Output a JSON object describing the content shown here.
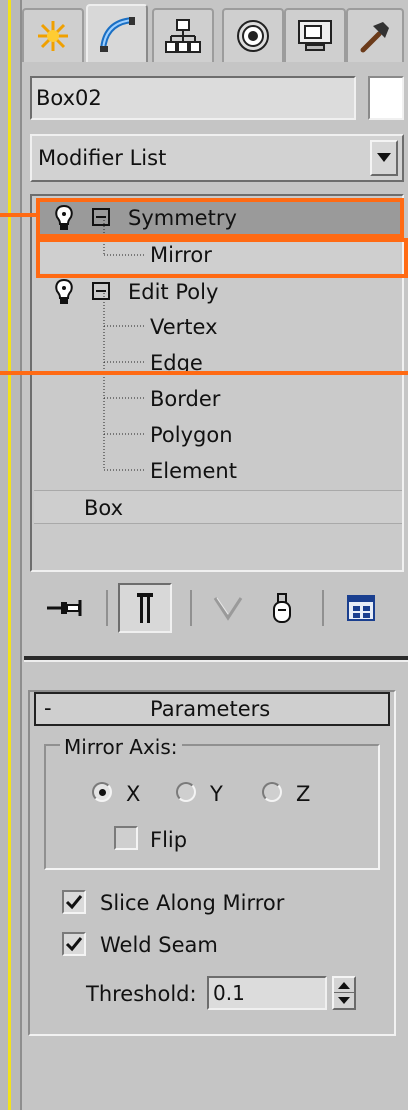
{
  "object": {
    "name": "Box02",
    "color": "#ffffff"
  },
  "modifier_list": {
    "label": "Modifier List"
  },
  "tabs": [
    {
      "name": "create-tab",
      "icon": "sun-icon"
    },
    {
      "name": "modify-tab",
      "icon": "modify-curve-icon",
      "active": true
    },
    {
      "name": "hierarchy-tab",
      "icon": "hierarchy-icon"
    },
    {
      "name": "motion-tab",
      "icon": "motion-target-icon"
    },
    {
      "name": "display-tab",
      "icon": "monitor-icon"
    },
    {
      "name": "utilities-tab",
      "icon": "hammer-icon"
    }
  ],
  "stack": {
    "symmetry": "Symmetry",
    "mirror": "Mirror",
    "edit_poly": "Edit Poly",
    "vertex": "Vertex",
    "edge": "Edge",
    "border": "Border",
    "polygon": "Polygon",
    "element": "Element",
    "box": "Box"
  },
  "rollout": {
    "collapse": "-",
    "title": "Parameters",
    "mirror_axis": {
      "label": "Mirror Axis:",
      "x": "X",
      "y": "Y",
      "z": "Z",
      "selected": "X"
    },
    "flip": {
      "label": "Flip",
      "checked": false
    },
    "slice": {
      "label": "Slice Along Mirror",
      "checked": true
    },
    "weld": {
      "label": "Weld Seam",
      "checked": true
    },
    "threshold": {
      "label": "Threshold:",
      "value": "0.1"
    }
  },
  "colors": {
    "highlight": "#ff6a13",
    "edge_line": "#f3e21b",
    "panel": "#c5c5c5",
    "selected_row": "#9a9a9a"
  }
}
